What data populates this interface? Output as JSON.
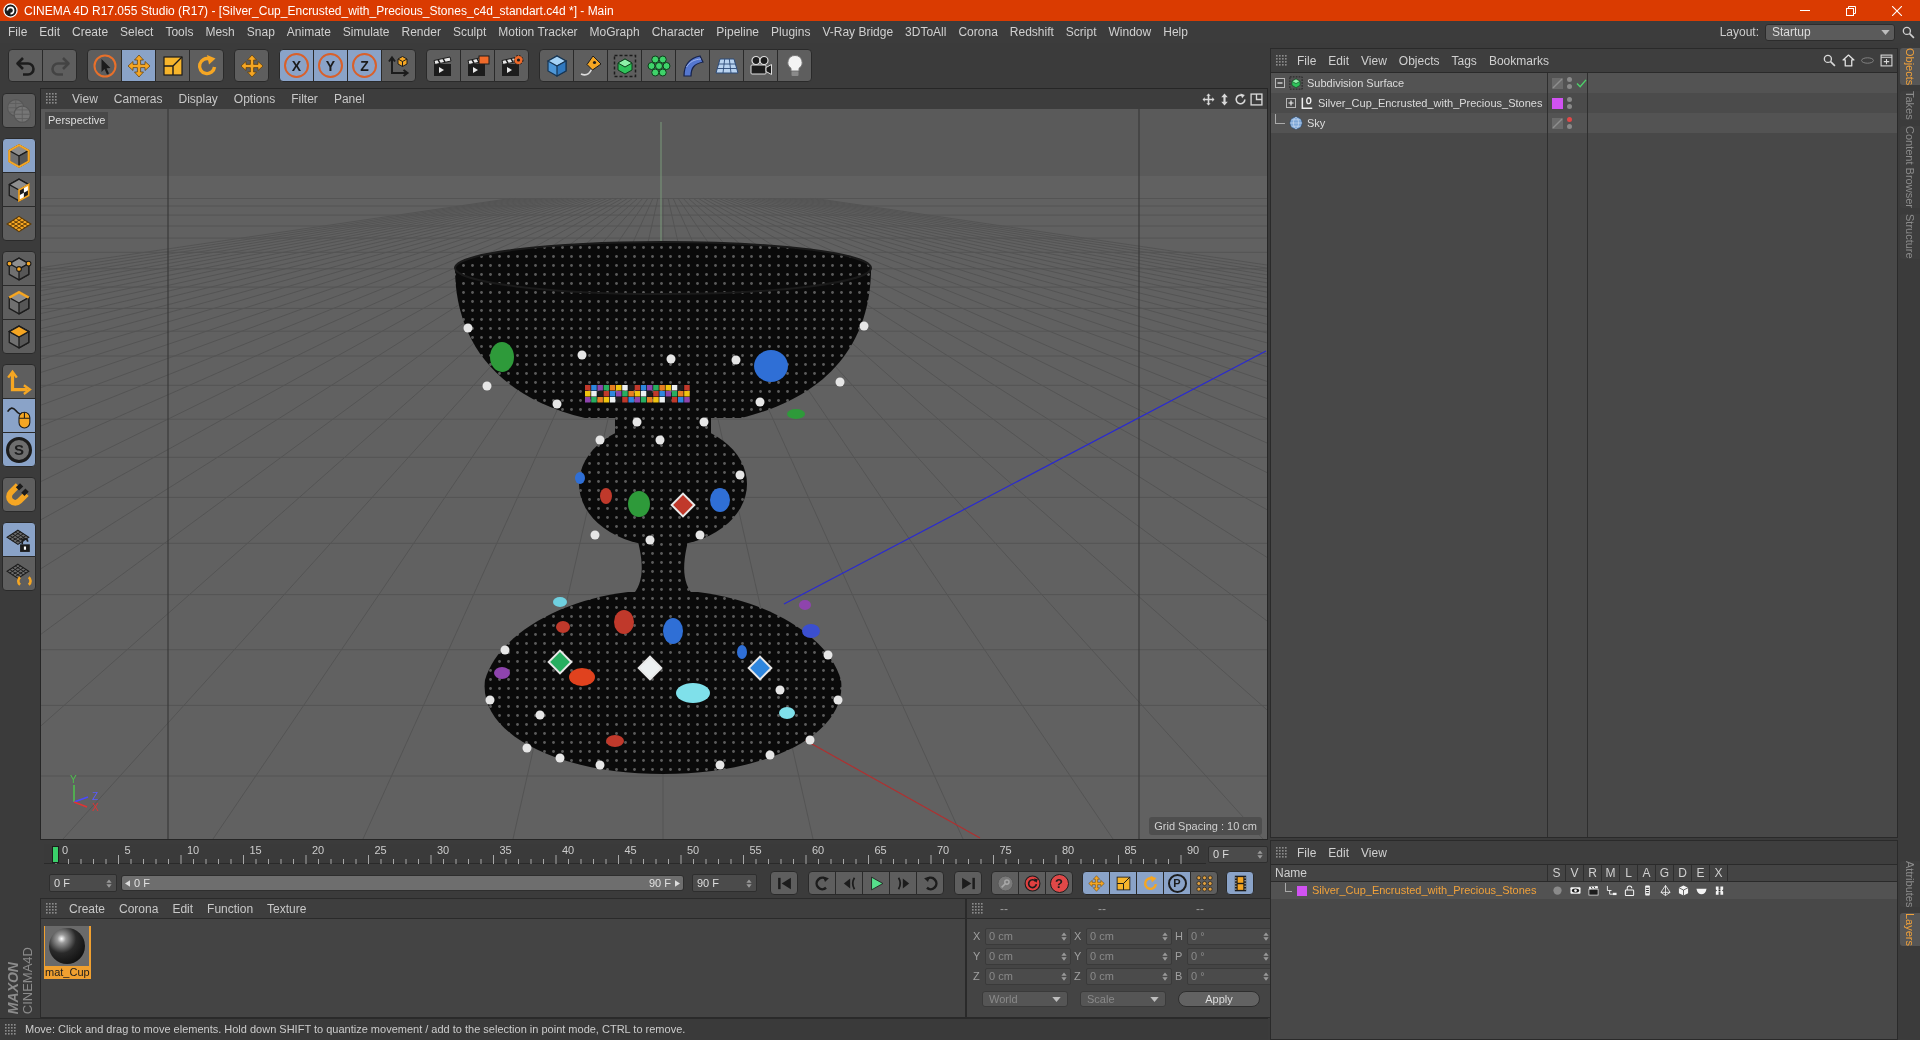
{
  "window": {
    "title": "CINEMA 4D R17.055 Studio (R17) - [Silver_Cup_Encrusted_with_Precious_Stones_c4d_standart.c4d *] - Main"
  },
  "menu_bar": [
    "File",
    "Edit",
    "Create",
    "Select",
    "Tools",
    "Mesh",
    "Snap",
    "Animate",
    "Simulate",
    "Render",
    "Sculpt",
    "Motion Tracker",
    "MoGraph",
    "Character",
    "Pipeline",
    "Plugins",
    "V-Ray Bridge",
    "3DToAll",
    "Corona",
    "Redshift",
    "Script",
    "Window",
    "Help"
  ],
  "layout": {
    "label": "Layout:",
    "value": "Startup"
  },
  "toolbar": [
    {
      "buttons": [
        {
          "kind": "undo",
          "selected": false,
          "disabled": false
        },
        {
          "kind": "redo",
          "selected": false,
          "disabled": true
        }
      ]
    },
    {
      "buttons": [
        {
          "kind": "select",
          "selected": false
        },
        {
          "kind": "move",
          "selected": true
        },
        {
          "kind": "scale",
          "selected": false
        },
        {
          "kind": "rotate",
          "selected": false
        }
      ]
    },
    {
      "buttons": [
        {
          "kind": "transform",
          "selected": false
        }
      ]
    },
    {
      "buttons": [
        {
          "kind": "axis",
          "label": "X",
          "selected": true
        },
        {
          "kind": "axis",
          "label": "Y",
          "selected": true
        },
        {
          "kind": "axis",
          "label": "Z",
          "selected": true
        },
        {
          "kind": "coordinates",
          "selected": false
        }
      ]
    },
    {
      "buttons": [
        {
          "kind": "renderview",
          "selected": false
        },
        {
          "kind": "renderpicture",
          "selected": false
        },
        {
          "kind": "rendersettings",
          "selected": false
        }
      ]
    },
    {
      "buttons": [
        {
          "kind": "cube",
          "selected": false
        },
        {
          "kind": "pen",
          "selected": false
        },
        {
          "kind": "subdivision",
          "selected": false
        },
        {
          "kind": "cloner",
          "selected": false
        },
        {
          "kind": "bend",
          "selected": false
        },
        {
          "kind": "floor",
          "selected": false
        },
        {
          "kind": "camera",
          "selected": false
        },
        {
          "kind": "light",
          "selected": false
        }
      ]
    }
  ],
  "tool_palette": [
    {
      "buttons": [
        {
          "kind": "makeeditable",
          "selected": false,
          "disabled": true
        }
      ]
    },
    {
      "buttons": [
        {
          "kind": "model",
          "selected": true
        },
        {
          "kind": "texture",
          "selected": false
        },
        {
          "kind": "workplane",
          "selected": false
        }
      ]
    },
    {
      "buttons": [
        {
          "kind": "points",
          "selected": false
        },
        {
          "kind": "edges",
          "selected": false
        },
        {
          "kind": "polygons",
          "selected": false
        }
      ]
    },
    {
      "buttons": [
        {
          "kind": "axismode",
          "selected": false
        },
        {
          "kind": "tweak",
          "selected": true
        },
        {
          "kind": "solo",
          "label": "S",
          "selected": true
        }
      ]
    },
    {
      "buttons": [
        {
          "kind": "snap",
          "selected": false
        }
      ]
    },
    {
      "buttons": [
        {
          "kind": "lockworkplane",
          "selected": true
        },
        {
          "kind": "planarworkplane",
          "selected": false
        }
      ]
    }
  ],
  "viewport": {
    "menu": [
      "View",
      "Cameras",
      "Display",
      "Options",
      "Filter",
      "Panel"
    ],
    "camera": "Perspective",
    "axis_gizmo": [
      "Y",
      "Z",
      "X"
    ],
    "grid_spacing": "Grid Spacing : 10 cm"
  },
  "timeline": {
    "labels": [
      "0",
      "5",
      "10",
      "15",
      "20",
      "25",
      "30",
      "35",
      "40",
      "45",
      "50",
      "55",
      "60",
      "65",
      "70",
      "75",
      "80",
      "85",
      "90"
    ],
    "playhead": {
      "level": 0
    },
    "current_frame": "0 F"
  },
  "frame_range": {
    "start": "0 F",
    "slider_start": "0 F",
    "slider_end": "90 F",
    "level": 1,
    "end": "90 F"
  },
  "transport": [
    {
      "buttons": [
        {
          "kind": "first",
          "selected": false
        }
      ]
    },
    {
      "buttons": [
        {
          "kind": "prevkey",
          "selected": false
        },
        {
          "kind": "prevframe",
          "selected": false
        },
        {
          "kind": "play",
          "selected": false
        },
        {
          "kind": "nextframe",
          "selected": false
        },
        {
          "kind": "nextkey",
          "selected": false
        }
      ]
    },
    {
      "buttons": [
        {
          "kind": "last",
          "selected": false
        }
      ]
    },
    {
      "buttons": [
        {
          "kind": "autokey",
          "selected": false
        },
        {
          "kind": "record",
          "selected": false
        },
        {
          "kind": "help",
          "label": "?",
          "selected": false
        }
      ]
    },
    {
      "buttons": [
        {
          "kind": "keymove",
          "selected": true
        },
        {
          "kind": "keyscale",
          "selected": true
        },
        {
          "kind": "keyrotate",
          "selected": true
        },
        {
          "kind": "param",
          "label": "P",
          "selected": true
        },
        {
          "kind": "pla",
          "selected": false
        }
      ]
    },
    {
      "buttons": [
        {
          "kind": "timelinewin",
          "selected": true
        }
      ]
    }
  ],
  "material_manager": {
    "menu": [
      "Create",
      "Corona",
      "Edit",
      "Function",
      "Texture"
    ],
    "materials": [
      {
        "name": "mat_Cup",
        "selected": true
      }
    ]
  },
  "coordinates": {
    "disabled": true,
    "headers": [
      "--",
      "--",
      "--"
    ],
    "rows": [
      [
        {
          "axis": "X",
          "value": "0 cm"
        },
        {
          "axis": "X",
          "value": "0 cm"
        },
        {
          "axis": "H",
          "value": "0 °"
        }
      ],
      [
        {
          "axis": "Y",
          "value": "0 cm"
        },
        {
          "axis": "Y",
          "value": "0 cm"
        },
        {
          "axis": "P",
          "value": "0 °"
        }
      ],
      [
        {
          "axis": "Z",
          "value": "0 cm"
        },
        {
          "axis": "Z",
          "value": "0 cm"
        },
        {
          "axis": "B",
          "value": "0 °"
        }
      ]
    ],
    "dropdowns": [
      "World",
      "Scale"
    ],
    "apply": "Apply"
  },
  "status_bar": "Move: Click and drag to move elements. Hold down SHIFT to quantize movement / add to the selection in point mode, CTRL to remove.",
  "logo": {
    "brand": "MAXON",
    "product": "CINEMA4D"
  },
  "object_manager": {
    "menu": [
      "File",
      "Edit",
      "View",
      "Objects",
      "Tags",
      "Bookmarks"
    ],
    "objects": [
      {
        "name": "Subdivision Surface",
        "kind": "subdivision",
        "expanded": true,
        "editor_hidden": false,
        "enabled": true,
        "children": [
          {
            "name": "Silver_Cup_Encrusted_with_Precious_Stones",
            "kind": "null",
            "expanded": false,
            "color": "#d152f2",
            "editor_hidden": false
          }
        ]
      },
      {
        "name": "Sky",
        "kind": "sky",
        "editor_hidden": true
      }
    ]
  },
  "layer_manager": {
    "menu": [
      "File",
      "Edit",
      "View"
    ],
    "columns": [
      "Name",
      "S",
      "V",
      "R",
      "M",
      "L",
      "A",
      "G",
      "D",
      "E",
      "X"
    ],
    "layers": [
      {
        "name": "Silver_Cup_Encrusted_with_Precious_Stones",
        "color": "#d152f2",
        "selected": true,
        "flags": [
          {
            "on": false
          },
          {
            "on": true
          },
          {
            "on": true
          },
          {
            "on": true
          },
          {
            "on": true
          },
          {
            "on": true
          },
          {
            "on": true
          },
          {
            "on": true
          },
          {
            "on": true
          },
          {
            "on": true
          }
        ]
      }
    ]
  },
  "side_tabs": {
    "top": [
      {
        "label": "Objects",
        "selected": true
      },
      {
        "label": "Takes",
        "selected": false
      },
      {
        "label": "Content Browser",
        "selected": false
      },
      {
        "label": "Structure",
        "selected": false
      }
    ],
    "bottom": [
      {
        "label": "Attributes",
        "selected": false
      },
      {
        "label": "Layers",
        "selected": true
      }
    ]
  }
}
